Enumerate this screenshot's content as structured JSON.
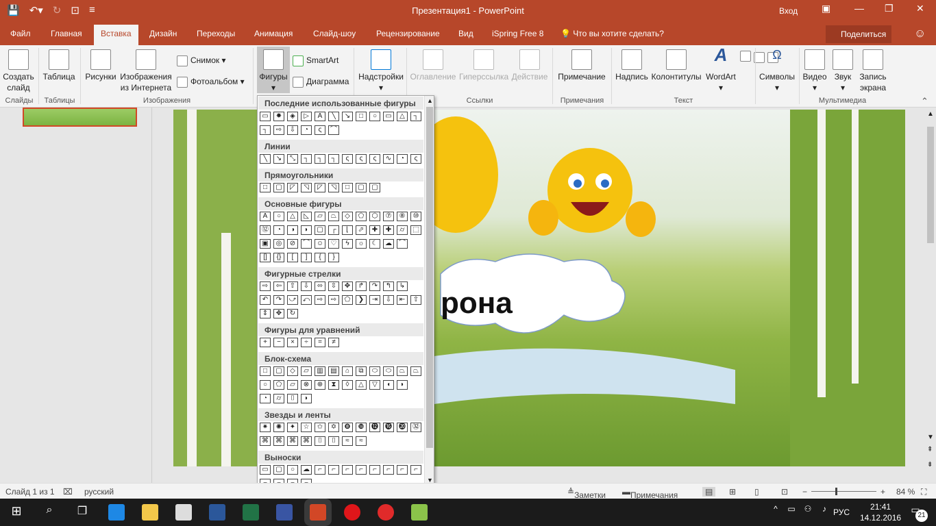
{
  "titlebar": {
    "title": "Презентация1 - PowerPoint",
    "login": "Вход"
  },
  "tabs": {
    "file": "Файл",
    "home": "Главная",
    "insert": "Вставка",
    "design": "Дизайн",
    "transitions": "Переходы",
    "animation": "Анимация",
    "slideshow": "Слайд-шоу",
    "review": "Рецензирование",
    "view": "Вид",
    "ispring": "iSpring Free 8",
    "tellme": "Что вы хотите сделать?",
    "share": "Поделиться"
  },
  "ribbon": {
    "new_slide": "Создать слайд",
    "table": "Таблица",
    "pictures": "Рисунки",
    "online_pictures": "Изображения из Интернета",
    "screenshot": "Снимок",
    "photo_album": "Фотоальбом",
    "shapes": "Фигуры",
    "smartart": "SmartArt",
    "chart": "Диаграмма",
    "addins": "Надстройки",
    "toc": "Оглавление",
    "hyperlink": "Гиперссылка",
    "action": "Действие",
    "comment": "Примечание",
    "textbox": "Надпись",
    "header_footer": "Колонтитулы",
    "wordart": "WordArt",
    "symbols": "Символы",
    "video": "Видео",
    "audio": "Звук",
    "screen_recording": "Запись экрана",
    "groups": {
      "slides": "Слайды",
      "tables": "Таблицы",
      "images": "Изображения",
      "links": "Ссылки",
      "comments": "Примечания",
      "text": "Текст",
      "media": "Мультимедиа"
    }
  },
  "gallery": {
    "recent": "Последние использованные фигуры",
    "lines": "Линии",
    "rectangles": "Прямоугольники",
    "basic": "Основные фигуры",
    "arrows": "Фигурные стрелки",
    "equation": "Фигуры для уравнений",
    "flowchart": "Блок-схема",
    "stars": "Звезды и ленты",
    "callouts": "Выноски"
  },
  "slide": {
    "cloud_text": "рона"
  },
  "status": {
    "slide_info": "Слайд 1 из 1",
    "language": "русский",
    "notes": "Заметки",
    "comments": "Примечания",
    "zoom": "84 %"
  },
  "taskbar": {
    "lang": "РУС",
    "time": "21:41",
    "date": "14.12.2016",
    "badge": "21"
  }
}
